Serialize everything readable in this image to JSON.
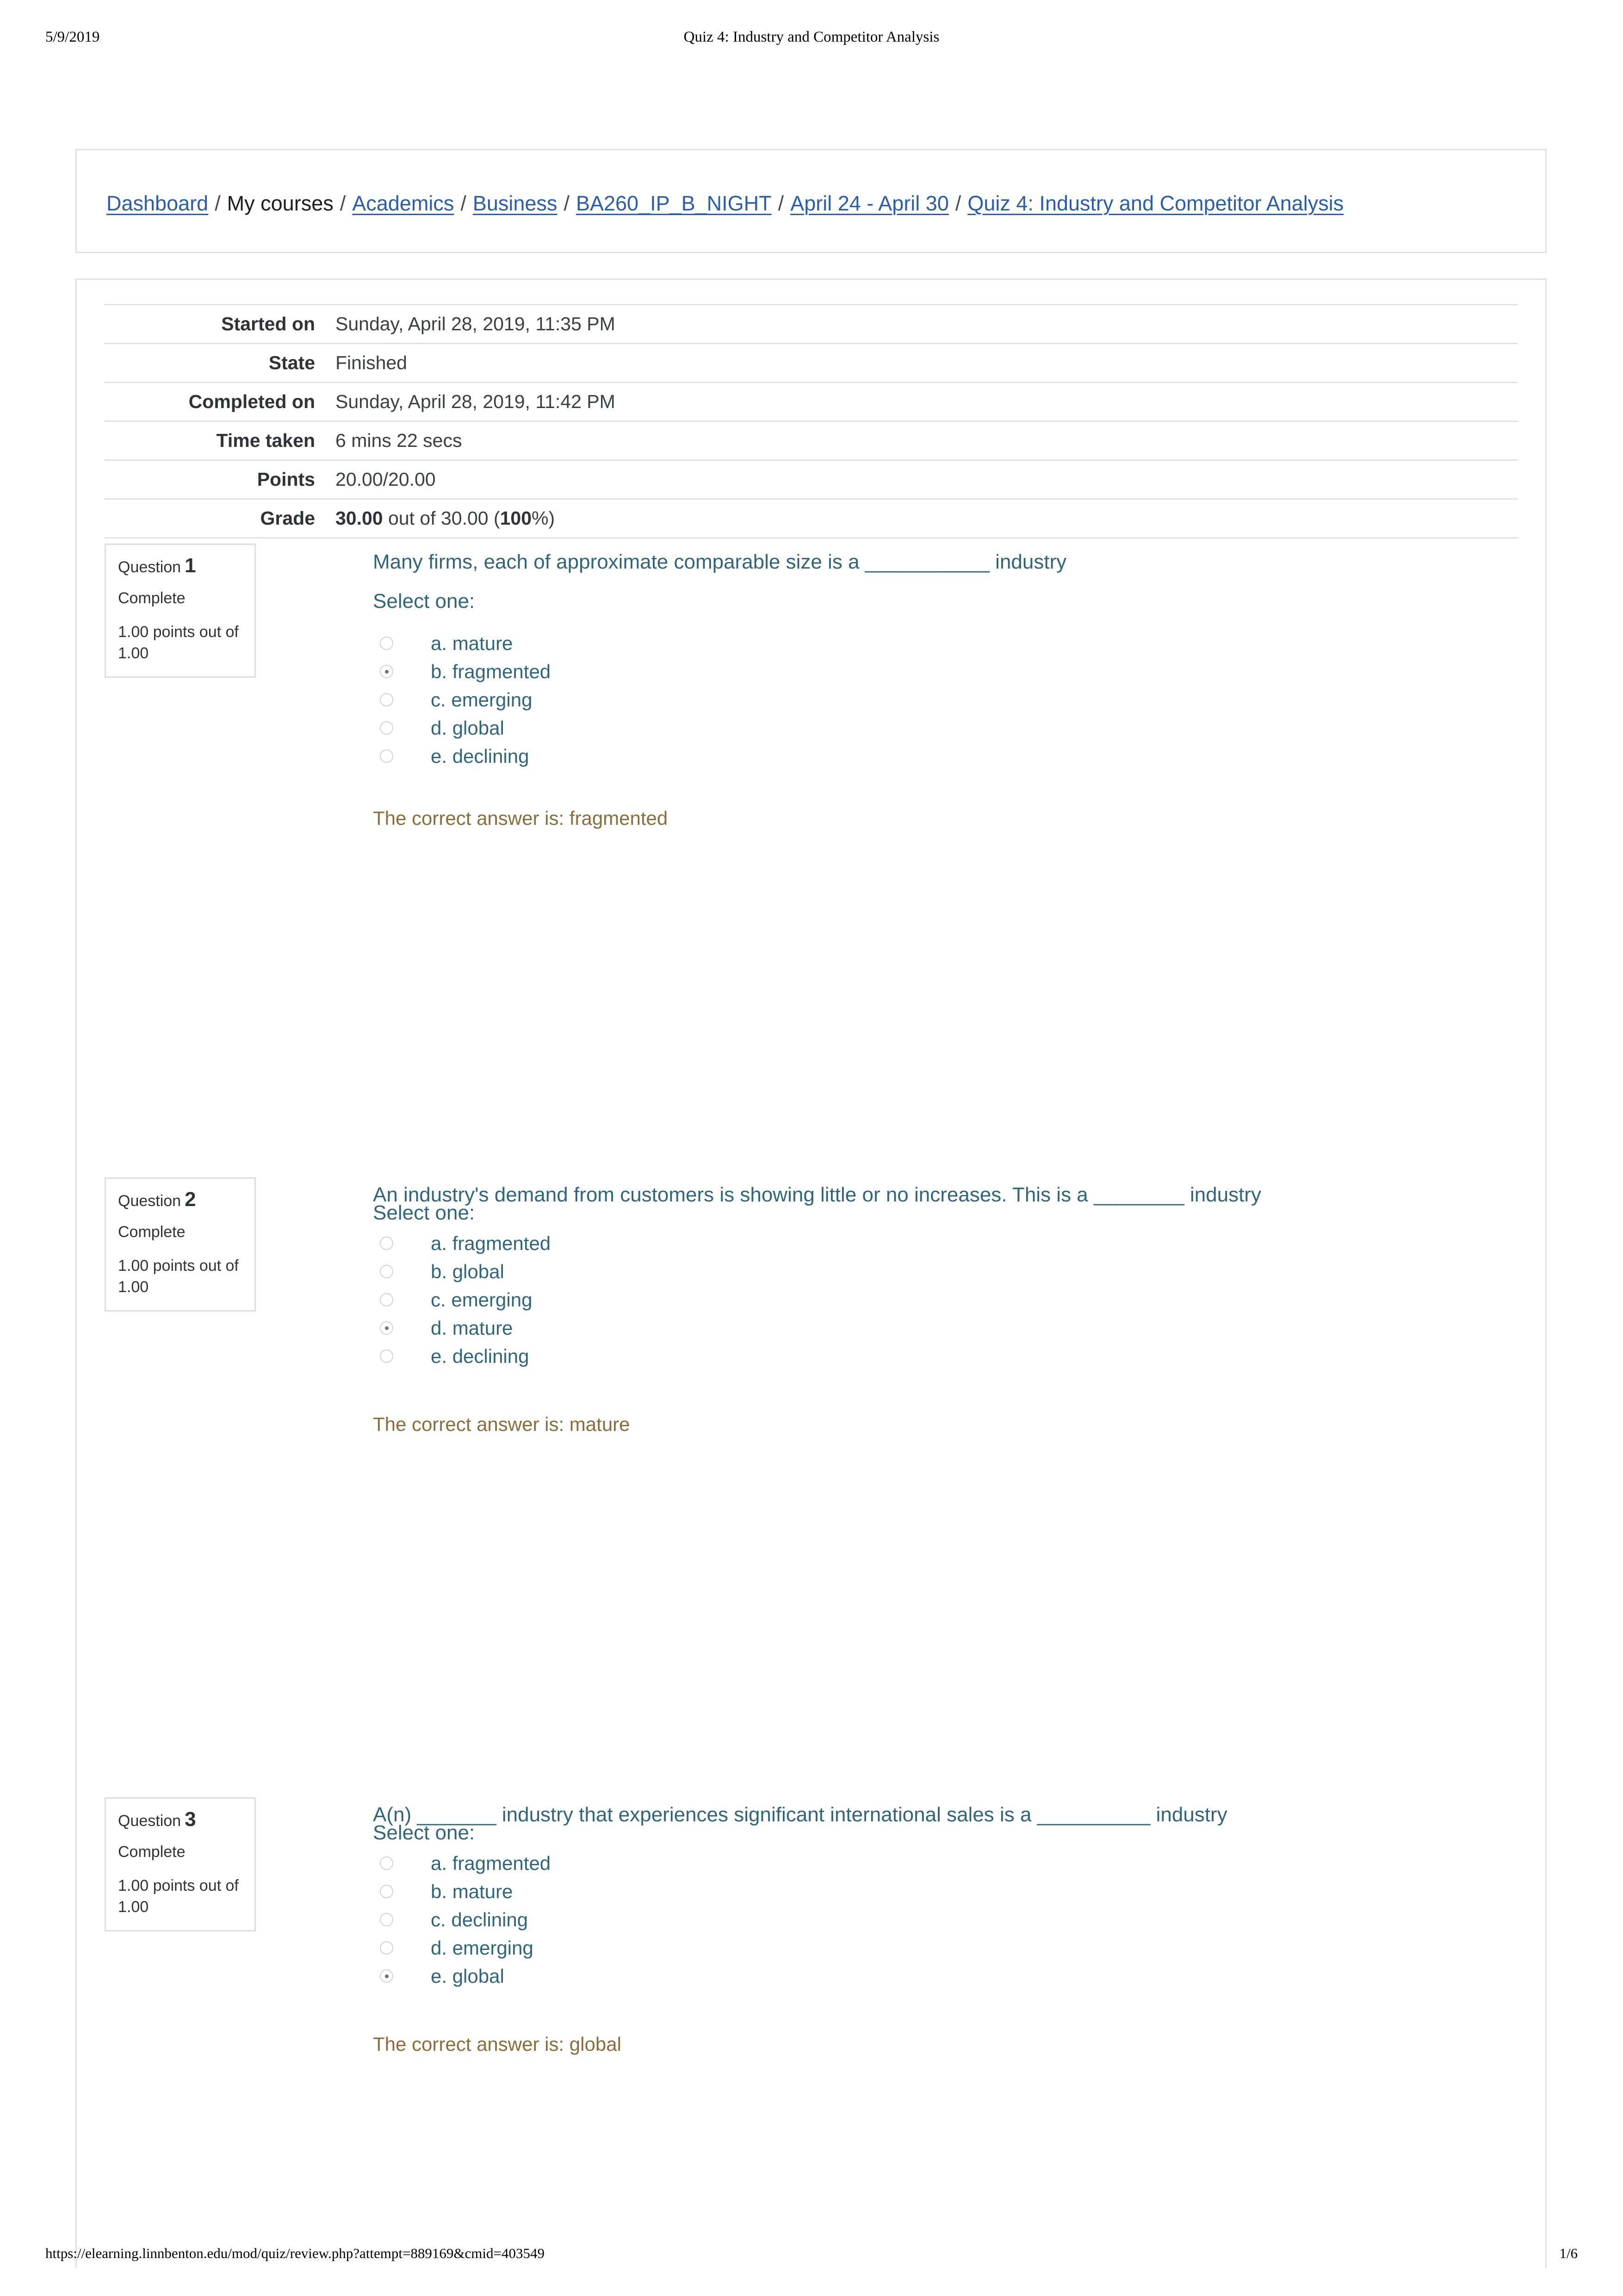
{
  "print_header": {
    "date": "5/9/2019",
    "title": "Quiz 4: Industry and Competitor Analysis"
  },
  "print_footer": {
    "url": "https://elearning.linnbenton.edu/mod/quiz/review.php?attempt=889169&cmid=403549",
    "page": "1/6"
  },
  "breadcrumb": {
    "items": [
      {
        "label": "Dashboard",
        "link": true
      },
      {
        "label": "My courses",
        "link": false
      },
      {
        "label": "Academics",
        "link": true
      },
      {
        "label": "Business",
        "link": true
      },
      {
        "label": "BA260_IP_B_NIGHT",
        "link": true
      },
      {
        "label": "April 24 - April 30",
        "link": true
      },
      {
        "label": "Quiz 4: Industry and Competitor Analysis",
        "link": true
      }
    ],
    "separator": "/"
  },
  "summary": {
    "rows": [
      {
        "label": "Started on",
        "value": "Sunday, April 28, 2019, 11:35 PM"
      },
      {
        "label": "State",
        "value": "Finished"
      },
      {
        "label": "Completed on",
        "value": "Sunday, April 28, 2019, 11:42 PM"
      },
      {
        "label": "Time taken",
        "value": "6 mins 22 secs"
      },
      {
        "label": "Points",
        "value": "20.00/20.00"
      }
    ],
    "grade": {
      "label": "Grade",
      "score": "30.00",
      "middle": " out of 30.00 (",
      "percent": "100",
      "suffix": "%)"
    }
  },
  "colors": {
    "link": "#2b5daa",
    "question_text": "#31657a",
    "feedback": "#8a6d3b",
    "panel_border": "#e0e1e3",
    "table_rule": "#dfe3e8",
    "radio_border": "#d2d2d2",
    "radio_dot": "#6c757d"
  },
  "select_one_label": "Select one:",
  "questions": [
    {
      "number_label": "Question",
      "number": "1",
      "state": "Complete",
      "grade": "1.00 points out of 1.00",
      "text": "Many firms, each of approximate comparable  size is a ___________ industry",
      "options": [
        {
          "label": "a. mature",
          "selected": false
        },
        {
          "label": "b. fragmented",
          "selected": true
        },
        {
          "label": "c. emerging",
          "selected": false
        },
        {
          "label": "d. global",
          "selected": false
        },
        {
          "label": "e. declining",
          "selected": false
        }
      ],
      "feedback": "The correct answer is: fragmented"
    },
    {
      "number_label": "Question",
      "number": "2",
      "state": "Complete",
      "grade": "1.00 points out of 1.00",
      "text": "An industry's demand from customers is showing little or no increases. This is a ________ industry",
      "options": [
        {
          "label": "a. fragmented",
          "selected": false
        },
        {
          "label": "b. global",
          "selected": false
        },
        {
          "label": "c. emerging",
          "selected": false
        },
        {
          "label": "d. mature",
          "selected": true
        },
        {
          "label": "e. declining",
          "selected": false
        }
      ],
      "feedback": "The correct answer is: mature"
    },
    {
      "number_label": "Question",
      "number": "3",
      "state": "Complete",
      "grade": "1.00 points out of 1.00",
      "text": "A(n) _______ industry that experiences significant international sales is a __________ industry",
      "options": [
        {
          "label": "a. fragmented",
          "selected": false
        },
        {
          "label": "b. mature",
          "selected": false
        },
        {
          "label": "c. declining",
          "selected": false
        },
        {
          "label": "d. emerging",
          "selected": false
        },
        {
          "label": "e. global",
          "selected": true
        }
      ],
      "feedback": "The correct answer is: global"
    }
  ]
}
